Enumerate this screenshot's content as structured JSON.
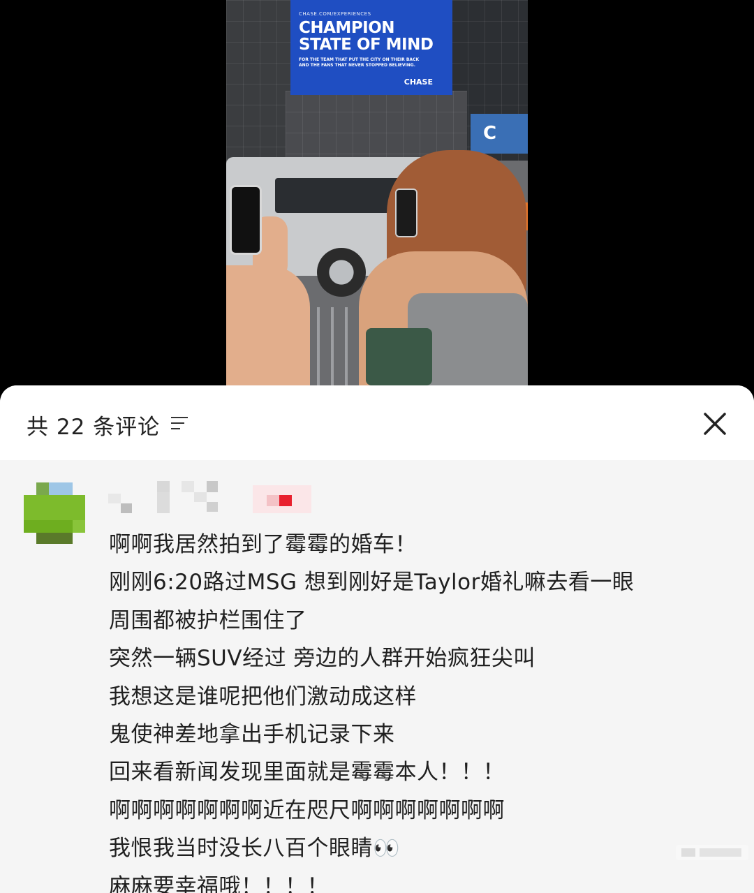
{
  "video": {
    "billboard_url": "CHASE.COM/EXPERIENCES",
    "billboard_headline_line1": "CHAMPION",
    "billboard_headline_line2": "STATE OF MIND",
    "billboard_subtext_line1": "FOR THE TEAM THAT PUT THE CITY ON THEIR BACK",
    "billboard_subtext_line2": "AND THE FANS THAT NEVER STOPPED BELIEVING.",
    "billboard_brand": "CHASE",
    "sign_letter": "C"
  },
  "comments_panel": {
    "count_label": "共 22 条评论",
    "sort_icon": "sort-lines-icon",
    "close_icon": "close-x-icon"
  },
  "comment": {
    "lines": [
      "啊啊我居然拍到了霉霉的婚车！",
      "刚刚6:20路过MSG 想到刚好是Taylor婚礼嘛去看一眼",
      "周围都被护栏围住了",
      "突然一辆SUV经过 旁边的人群开始疯狂尖叫",
      "我想这是谁呢把他们激动成这样",
      "鬼使神差地拿出手机记录下来",
      "回来看新闻发现里面就是霉霉本人！！！",
      "啊啊啊啊啊啊啊近在咫尺啊啊啊啊啊啊啊",
      "我恨我当时没长八百个眼睛👀",
      "麻麻要幸福哦！！！！"
    ]
  },
  "colors": {
    "panel_bg": "#f5f5f5",
    "header_bg": "#ffffff",
    "text": "#1f1f1f",
    "billboard_blue": "#1f4ec2"
  }
}
